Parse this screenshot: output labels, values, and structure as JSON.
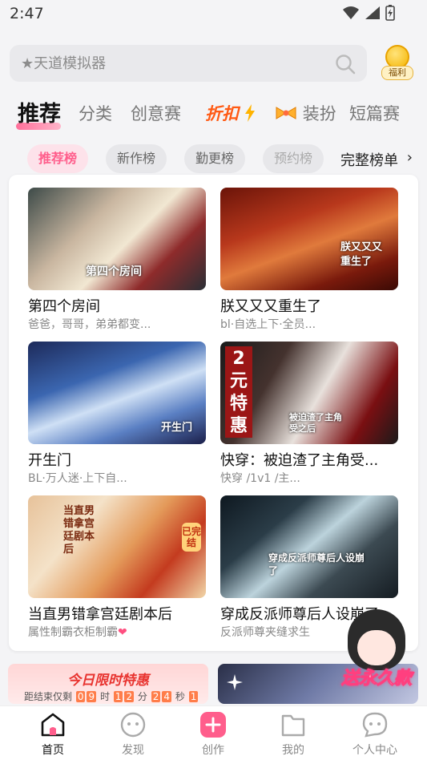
{
  "status": {
    "time": "2:47"
  },
  "search": {
    "placeholder": "★天道模拟器"
  },
  "welfare": {
    "label": "福利"
  },
  "tabs": [
    {
      "label": "推荐"
    },
    {
      "label": "分类"
    },
    {
      "label": "创意赛"
    },
    {
      "label": "折扣"
    },
    {
      "label": "装扮"
    },
    {
      "label": "短篇赛"
    }
  ],
  "chips": [
    {
      "label": "推荐榜"
    },
    {
      "label": "新作榜"
    },
    {
      "label": "勤更榜"
    },
    {
      "label": "预约榜"
    }
  ],
  "full_list_label": "完整榜单",
  "books": [
    {
      "title": "第四个房间",
      "desc": "爸爸，哥哥，弟弟都变...",
      "cover_text": "第四个房间"
    },
    {
      "title": "朕又又又重生了",
      "desc": "bl·自选上下·全员...",
      "cover_text": "朕又又又重生了"
    },
    {
      "title": "开生门",
      "desc": "BL·万人迷·上下自...",
      "cover_text": "开生门"
    },
    {
      "title": "快穿：被迫渣了主角受...",
      "desc": "快穿 /1v1 /主...",
      "cover_text": "被迫渣了主角受之后",
      "badge": "2元特惠"
    },
    {
      "title": "当直男错拿宫廷剧本后",
      "desc": "属性制霸衣柜制霸",
      "cover_text": "当直男错拿宫廷剧本后",
      "stamp": "已完结"
    },
    {
      "title": "穿成反派师尊后人设崩了",
      "desc": "反派师尊夹缝求生",
      "cover_text": "穿成反派师尊后人设崩了"
    }
  ],
  "promo": {
    "title": "今日限时特惠",
    "countdown_prefix": "距结束仅剩",
    "h1": "0",
    "h2": "9",
    "h_unit": "时",
    "m1": "1",
    "m2": "2",
    "m_unit": "分",
    "s1": "2",
    "s2": "4",
    "s_unit": "秒",
    "ms": "1"
  },
  "mascot_label": "送永久款",
  "nav": [
    {
      "label": "首页"
    },
    {
      "label": "发现"
    },
    {
      "label": "创作"
    },
    {
      "label": "我的"
    },
    {
      "label": "个人中心"
    }
  ],
  "colors": {
    "accent": "#ff5e8c",
    "discount": "#ff5a14",
    "promo_red": "#e8332f"
  }
}
